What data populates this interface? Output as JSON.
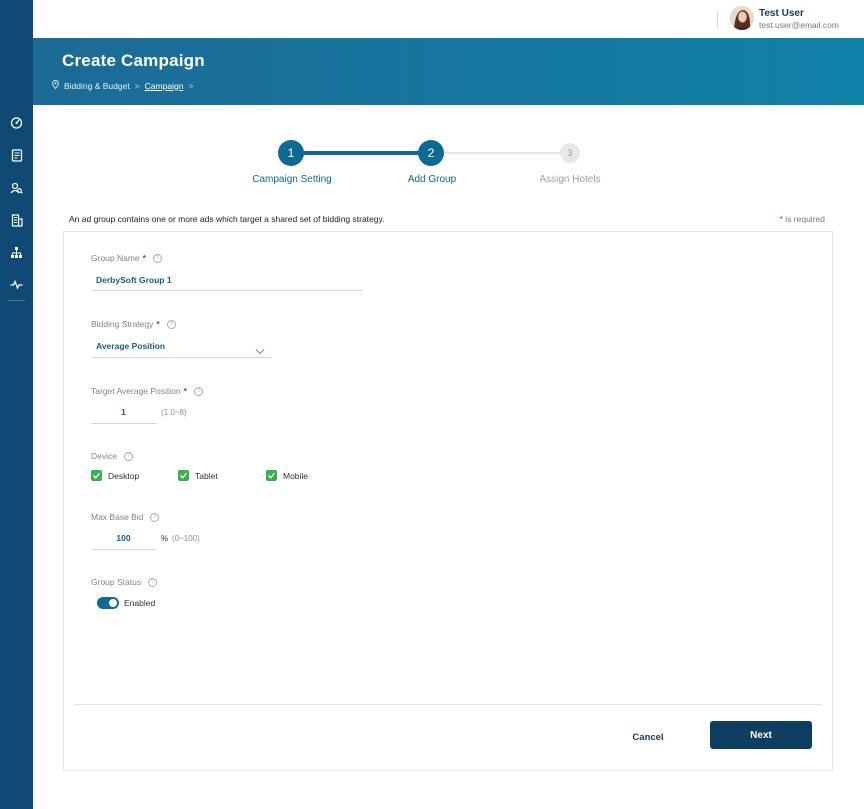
{
  "sidebar": {
    "icons": [
      "dashboard-icon",
      "document-icon",
      "search-user-icon",
      "building-icon",
      "hierarchy-icon",
      "activity-icon"
    ]
  },
  "user": {
    "name": "Test User",
    "email": "test.user@email.com"
  },
  "header": {
    "title": "Create Campaign",
    "breadcrumb": {
      "item1": "Bidding & Budget",
      "sep1": ">",
      "item2": "Campaign",
      "sep2": ">"
    }
  },
  "stepper": {
    "steps": [
      {
        "number": "1",
        "label": "Campaign Setting",
        "state": "done"
      },
      {
        "number": "2",
        "label": "Add Group",
        "state": "active"
      },
      {
        "number": "3",
        "label": "Assign Hotels",
        "state": "todo"
      }
    ]
  },
  "description": "An ad group contains one or more ads which target a shared set of bidding strategy.",
  "required_note": {
    "star": "*",
    "text": " is required"
  },
  "form": {
    "group_name": {
      "label": "Group Name",
      "required_mark": "*",
      "value": "DerbySoft Group 1"
    },
    "bidding_strategy": {
      "label": "Bidding Strategy",
      "required_mark": "*",
      "value": "Average Position"
    },
    "target_avg_position": {
      "label": "Target Average Position",
      "required_mark": "*",
      "value": "1",
      "hint": "(1.0~8)"
    },
    "device": {
      "label": "Device",
      "options": [
        {
          "label": "Desktop",
          "checked": true
        },
        {
          "label": "Tablet",
          "checked": true
        },
        {
          "label": "Mobile",
          "checked": true
        }
      ]
    },
    "max_base_bid": {
      "label": "Max Base Bid",
      "value": "100",
      "unit": "%",
      "hint": "(0~100)"
    },
    "group_status": {
      "label": "Group Status",
      "toggle_on": true,
      "value_label": "Enabled"
    }
  },
  "actions": {
    "cancel": "Cancel",
    "next": "Next"
  },
  "colors": {
    "sidebar": "#0e4a73",
    "primary": "#0e6a92",
    "next_button": "#0e3f63",
    "checkbox": "#37b24d",
    "required": "#d02525"
  }
}
